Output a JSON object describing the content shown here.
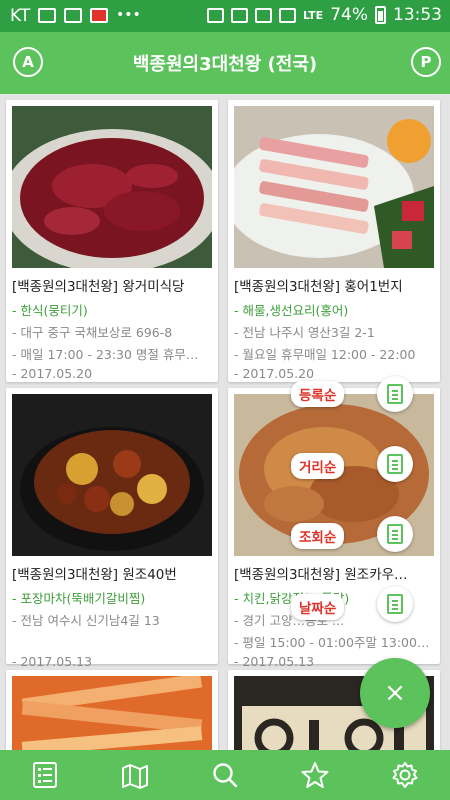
{
  "status_bar": {
    "carrier": "KT",
    "battery": "74%",
    "time": "13:53",
    "network": "LTE"
  },
  "app_bar": {
    "title": "백종원의3대천왕 (전국)",
    "left_button": "A",
    "right_button": "P"
  },
  "cards": [
    {
      "name": "[백종원의3대천왕] 왕거미식당",
      "category": "- 한식(뭉티기)",
      "address": "- 대구 중구 국채보상로 696-8",
      "hours": "- 매일 17:00 - 23:30 명절 휴무…",
      "date": "- 2017.05.20"
    },
    {
      "name": "[백종원의3대천왕] 홍어1번지",
      "category": "- 해물,생선요리(홍어)",
      "address": "- 전남 나주시 영산3길 2-1",
      "hours": "- 월요일 휴무매일 12:00 - 22:00",
      "date": "- 2017.05.20"
    },
    {
      "name": "[백종원의3대천왕] 원조40번",
      "category": "- 포장마차(뚝배기갈비찜)",
      "address": "- 전남 여수시 신기남4길 13",
      "hours": "",
      "date": "- 2017.05.13"
    },
    {
      "name": "[백종원의3대천왕] 원조카우…",
      "category": "- 치킨,닭강정(…통닭)",
      "address": "- 경기 고양…용로 …",
      "hours": "- 평일 15:00 - 01:00주말 13:00…",
      "date": "- 2017.05.13"
    }
  ],
  "sort_menu": {
    "registered": "등록순",
    "distance": "거리순",
    "views": "조회순",
    "date": "날짜순"
  },
  "fab_label": "×",
  "bottom_nav": [
    "list-icon",
    "map-icon",
    "search-icon",
    "star-icon",
    "settings-icon"
  ],
  "colors": {
    "status_bar": "#2ea043",
    "primary": "#5bc25c",
    "category_text": "#3e9e3a",
    "sort_label_text": "#e0332a"
  }
}
